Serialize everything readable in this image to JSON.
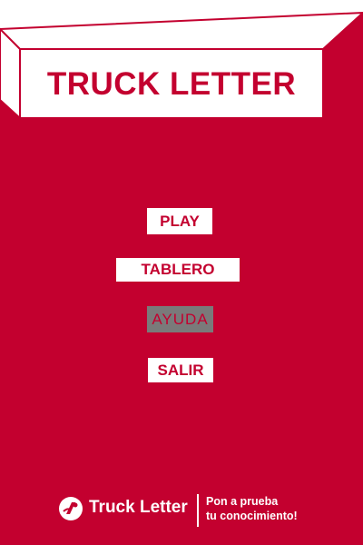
{
  "app": {
    "title": "TRUCK LETTER"
  },
  "menu": {
    "play_label": "PLAY",
    "board_label": "TABLERO",
    "help_label": "AYUDA",
    "exit_label": "SALIR",
    "highlighted_item": "AYUDA"
  },
  "footer": {
    "brand_name": "Truck Letter",
    "brand_icon": "truck-letter-logo-icon",
    "tagline_line1": "Pon a prueba",
    "tagline_line2": "tu conocimiento!"
  },
  "colors": {
    "background": "#c3002f",
    "button_background": "#ffffff",
    "button_text": "#c3002f",
    "highlight_background": "#7a7a7a"
  }
}
